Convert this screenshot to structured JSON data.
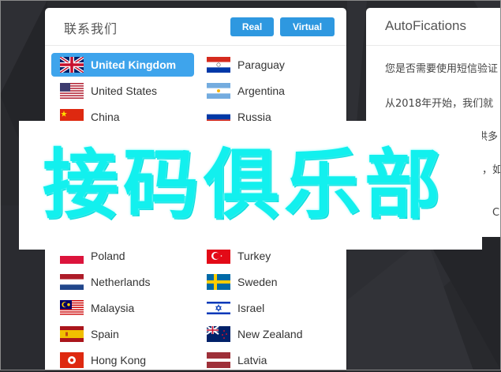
{
  "left_panel": {
    "title": "联系我们",
    "buttons": {
      "real": "Real",
      "virtual": "Virtual"
    },
    "countries_col1": [
      {
        "name": "United Kingdom",
        "flag": "uk-flag-icon",
        "active": true
      },
      {
        "name": "United States",
        "flag": "us-flag-icon"
      },
      {
        "name": "China",
        "flag": "china-flag-icon"
      },
      {
        "name": "Poland",
        "flag": "poland-flag-icon"
      },
      {
        "name": "Netherlands",
        "flag": "netherlands-flag-icon"
      },
      {
        "name": "Malaysia",
        "flag": "malaysia-flag-icon"
      },
      {
        "name": "Spain",
        "flag": "spain-flag-icon"
      },
      {
        "name": "Hong Kong",
        "flag": "hong-kong-flag-icon"
      }
    ],
    "countries_col2": [
      {
        "name": "Paraguay",
        "flag": "paraguay-flag-icon"
      },
      {
        "name": "Argentina",
        "flag": "argentina-flag-icon"
      },
      {
        "name": "Russia",
        "flag": "russia-flag-icon"
      },
      {
        "name": "Turkey",
        "flag": "turkey-flag-icon"
      },
      {
        "name": "Sweden",
        "flag": "sweden-flag-icon"
      },
      {
        "name": "Israel",
        "flag": "israel-flag-icon"
      },
      {
        "name": "New Zealand",
        "flag": "new-zealand-flag-icon"
      },
      {
        "name": "Latvia",
        "flag": "latvia-flag-icon"
      }
    ]
  },
  "right_panel": {
    "title": "AutoFications",
    "paragraphs": [
      "您是否需要使用短信验证",
      "从2018年开始，我们就",
      "提供多",
      "目，如",
      "C"
    ]
  },
  "watermark": {
    "text": "接码俱乐部"
  },
  "colors": {
    "accent": "#2e98e0",
    "active_item": "#3ea4ec",
    "watermark": "#12f0ee",
    "background": "#27282c"
  }
}
